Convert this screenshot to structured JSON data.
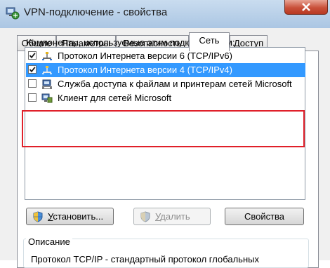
{
  "window": {
    "title": "VPN-подключение - свойства",
    "icon": "network-connection-icon"
  },
  "tabs": [
    {
      "label": "Общие",
      "active": false
    },
    {
      "label": "Параметры",
      "active": false
    },
    {
      "label": "Безопасность",
      "active": false
    },
    {
      "label": "Сеть",
      "active": true
    },
    {
      "label": "Доступ",
      "active": false
    }
  ],
  "components": {
    "label": "Компоненты, используемые этим подключением:",
    "items": [
      {
        "label": "Протокол Интернета версии 6 (TCP/IPv6)",
        "checked": true,
        "selected": false,
        "icon": "protocol-icon"
      },
      {
        "label": "Протокол Интернета версии 4 (TCP/IPv4)",
        "checked": true,
        "selected": true,
        "icon": "protocol-icon"
      },
      {
        "label": "Служба доступа к файлам и принтерам сетей Microsoft",
        "checked": false,
        "selected": false,
        "icon": "file-printer-sharing-icon"
      },
      {
        "label": "Клиент для сетей Microsoft",
        "checked": false,
        "selected": false,
        "icon": "network-client-icon"
      }
    ]
  },
  "buttons": {
    "install": {
      "prefix": "У",
      "rest": "становить...",
      "enabled": true
    },
    "remove": {
      "prefix": "У",
      "rest": "далить",
      "enabled": false
    },
    "properties": {
      "label": "Свойства",
      "enabled": true
    }
  },
  "description": {
    "title": "Описание",
    "text": "Протокол TCP/IP - стандартный протокол глобальных"
  },
  "colors": {
    "selection": "#3399ff",
    "highlight_box": "#e0202a",
    "close_button": "#c9503a"
  }
}
